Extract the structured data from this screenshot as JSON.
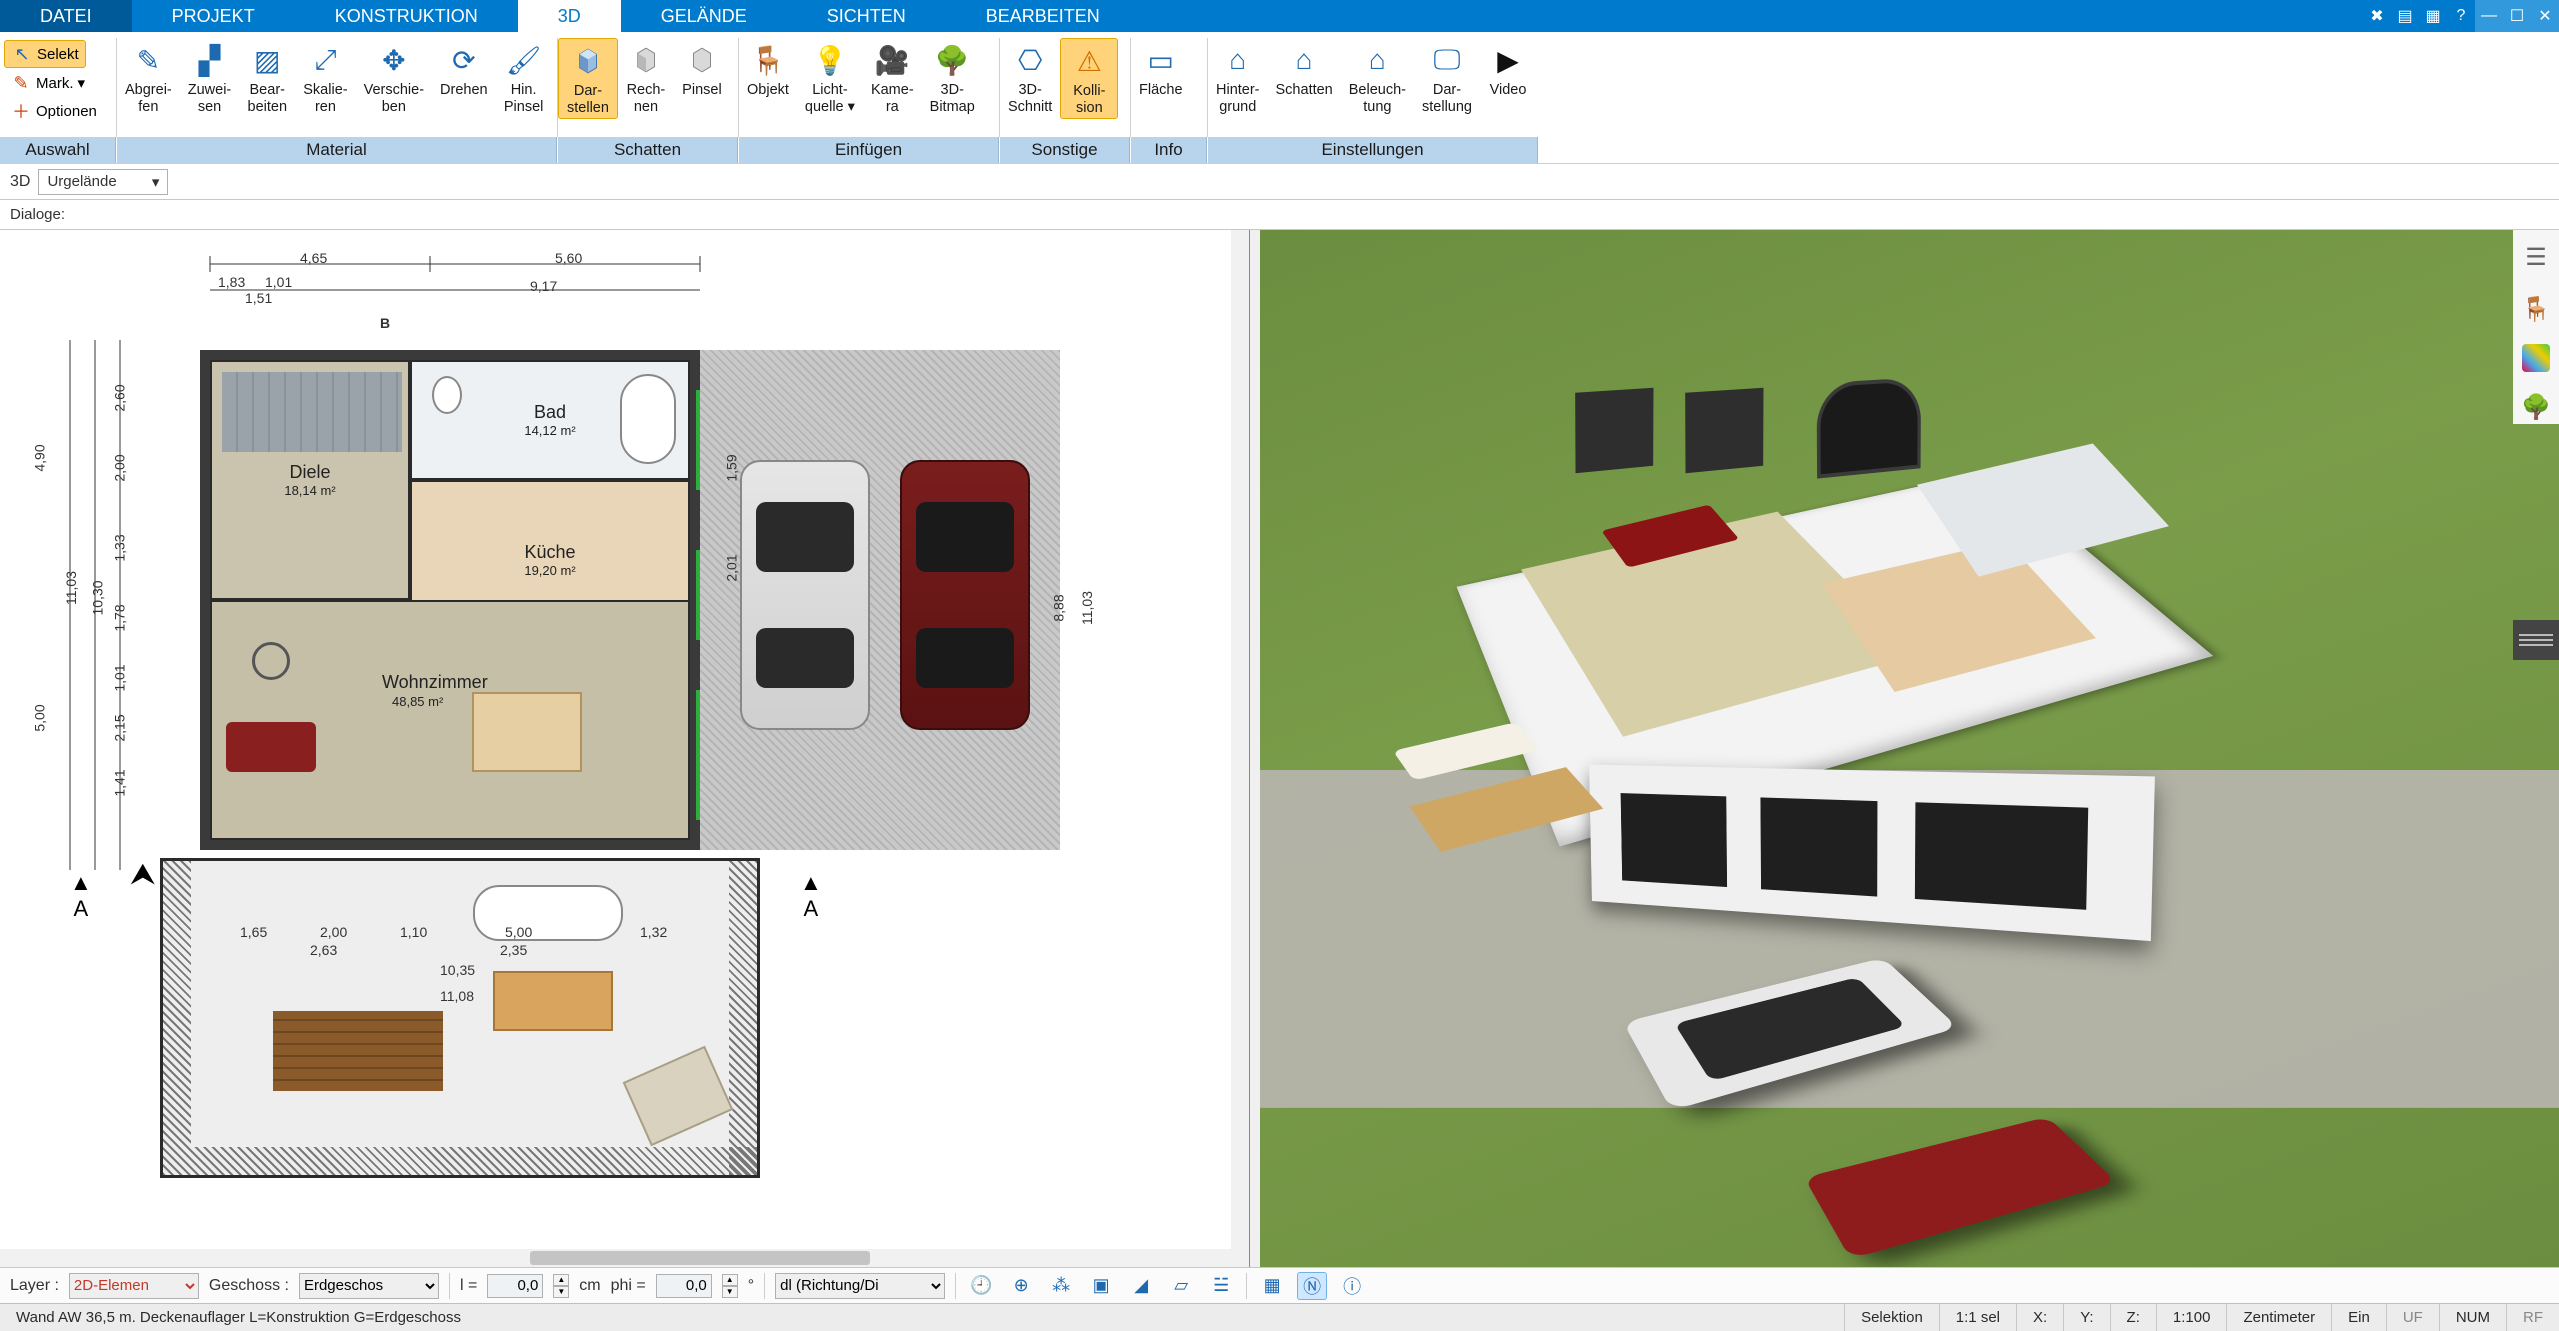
{
  "menu": {
    "tabs": [
      "DATEI",
      "PROJEKT",
      "KONSTRUKTION",
      "3D",
      "GELÄNDE",
      "SICHTEN",
      "BEARBEITEN"
    ],
    "active_index": 3
  },
  "ribbon": {
    "auswahl": {
      "label": "Auswahl",
      "selekt": "Selekt",
      "mark": "Mark.",
      "optionen": "Optionen"
    },
    "material": {
      "label": "Material",
      "items": [
        {
          "cap": "Abgrei-\nfen"
        },
        {
          "cap": "Zuwei-\nsen"
        },
        {
          "cap": "Bear-\nbeiten"
        },
        {
          "cap": "Skalie-\nren"
        },
        {
          "cap": "Verschie-\nben"
        },
        {
          "cap": "Drehen"
        },
        {
          "cap": "Hin.\nPinsel"
        }
      ]
    },
    "schatten": {
      "label": "Schatten",
      "items": [
        {
          "cap": "Dar-\nstellen",
          "active": true
        },
        {
          "cap": "Rech-\nnen"
        },
        {
          "cap": "Pinsel"
        }
      ]
    },
    "einfuegen": {
      "label": "Einfügen",
      "items": [
        {
          "cap": "Objekt"
        },
        {
          "cap": "Licht-\nquelle ▾"
        },
        {
          "cap": "Kame-\nra"
        },
        {
          "cap": "3D-\nBitmap"
        }
      ]
    },
    "sonstige": {
      "label": "Sonstige",
      "items": [
        {
          "cap": "3D-\nSchnitt"
        },
        {
          "cap": "Kolli-\nsion",
          "active": true
        }
      ]
    },
    "info": {
      "label": "Info",
      "items": [
        {
          "cap": "Fläche"
        }
      ]
    },
    "einstellungen": {
      "label": "Einstellungen",
      "items": [
        {
          "cap": "Hinter-\ngrund"
        },
        {
          "cap": "Schatten"
        },
        {
          "cap": "Beleuch-\ntung"
        },
        {
          "cap": "Dar-\nstellung"
        },
        {
          "cap": "Video"
        }
      ]
    }
  },
  "subbar": {
    "mode": "3D",
    "selection": "Urgelände"
  },
  "dialoge_label": "Dialoge:",
  "plan2d": {
    "dims": {
      "top_left": "4,65",
      "top_right": "5,60",
      "top_total": "9,17",
      "top_small_a": "1,83",
      "top_small_b": "1,01",
      "top_small_c": "1,51",
      "left_top": "2,60",
      "left_mid_a": "2,00",
      "left_mid_b": "10,30",
      "left_big": "11,03",
      "left_h": "4,90",
      "left_low": "5,00",
      "left_1": "1,33",
      "left_2": "1,78",
      "left_3": "1,01",
      "left_4": "2,15",
      "left_5": "1,41",
      "right_a": "2,01",
      "right_b": "1,59",
      "right_c": "11,03",
      "right_d": "8,88",
      "garden_a": "1,65",
      "garden_b": "2,00",
      "garden_c": "1,10",
      "garden_d": "5,00",
      "garden_da": "2,63",
      "garden_db": "2,35",
      "garden_e": "1,32",
      "garden_tot": "10,35",
      "garden_tot2": "11,08"
    },
    "section_marker": "A",
    "plan_marker": "B",
    "rooms": {
      "diele": {
        "name": "Diele",
        "area": "18,14 m²"
      },
      "bad": {
        "name": "Bad",
        "area": "14,12 m²"
      },
      "kueche": {
        "name": "Küche",
        "area": "19,20 m²"
      },
      "wohn": {
        "name": "Wohnzimmer",
        "area": "48,85 m²"
      }
    }
  },
  "optbar": {
    "layer_label": "Layer :",
    "layer_value": "2D-Elemen",
    "geschoss_label": "Geschoss :",
    "geschoss_value": "Erdgeschos",
    "l_label": "l =",
    "l_value": "0,0",
    "l_unit": "cm",
    "phi_label": "phi =",
    "phi_value": "0,0",
    "richtung": "dl (Richtung/Di"
  },
  "status": {
    "left": "Wand AW 36,5 m. Deckenauflager L=Konstruktion G=Erdgeschoss",
    "selektion": "Selektion",
    "sel": "1:1 sel",
    "x": "X:",
    "y": "Y:",
    "z": "Z:",
    "scale": "1:100",
    "unit": "Zentimeter",
    "ein": "Ein",
    "uf": "UF",
    "num": "NUM",
    "rf": "RF"
  }
}
